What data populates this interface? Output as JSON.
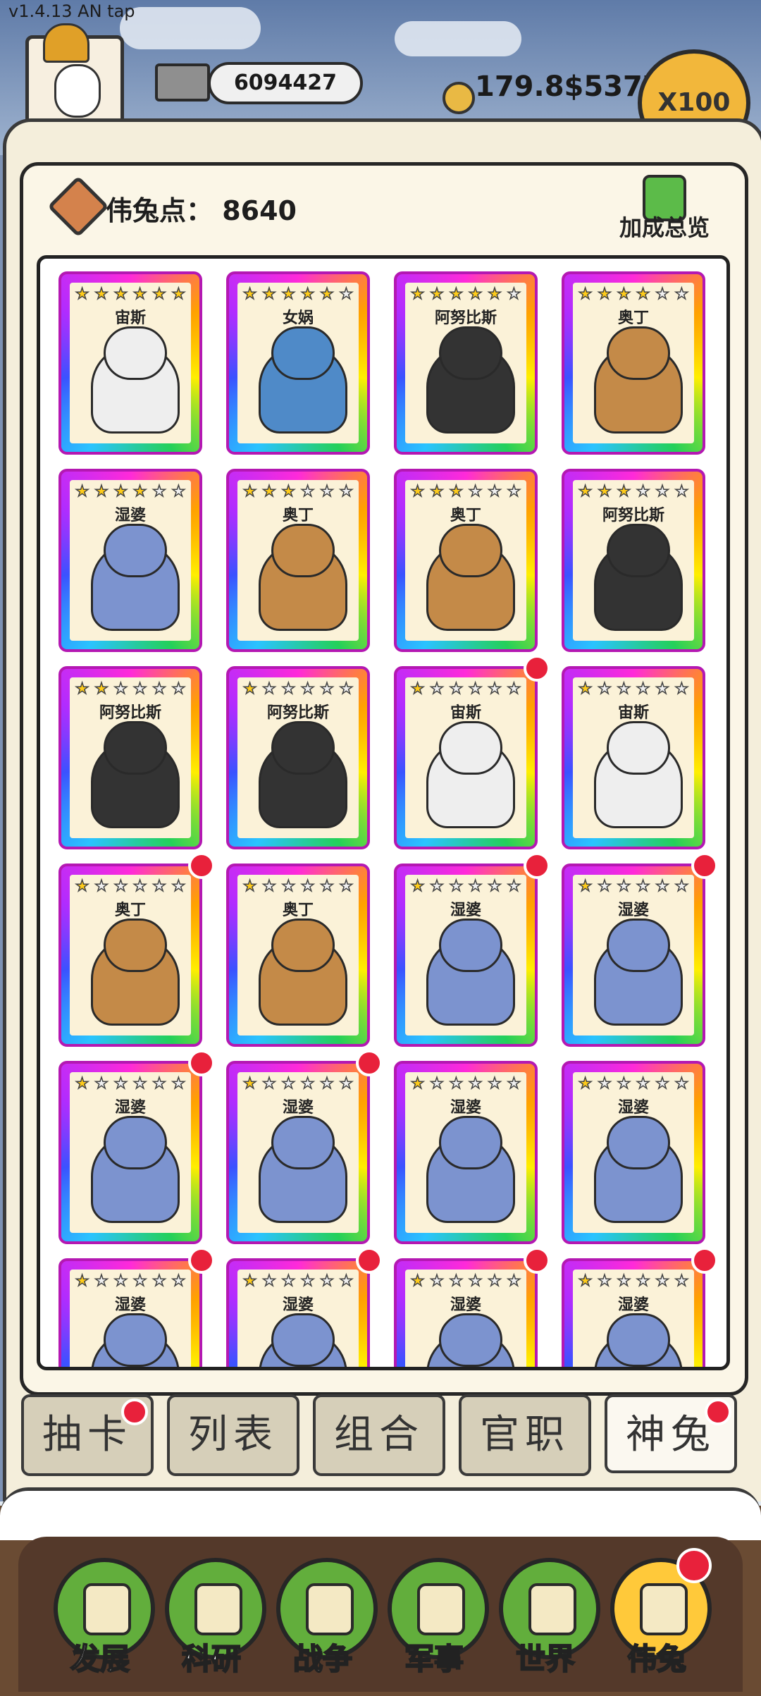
{
  "version_label": "v1.4.13 AN tap",
  "resources": {
    "silver": "6094427",
    "gold": "179.8$5377",
    "multiplier_button": "X100"
  },
  "panel": {
    "points_label": "伟兔点： 8640",
    "overview_label": "加成总览"
  },
  "cards": [
    {
      "name": "宙斯",
      "stars": 6,
      "badge": false,
      "color": "#eeeeee"
    },
    {
      "name": "女娲",
      "stars": 5,
      "badge": false,
      "color": "#4f8ac8"
    },
    {
      "name": "阿努比斯",
      "stars": 5,
      "badge": false,
      "color": "#333333"
    },
    {
      "name": "奥丁",
      "stars": 4,
      "badge": false,
      "color": "#c48a48"
    },
    {
      "name": "湿婆",
      "stars": 4,
      "badge": false,
      "color": "#7c93cf"
    },
    {
      "name": "奥丁",
      "stars": 3,
      "badge": false,
      "color": "#c48a48"
    },
    {
      "name": "奥丁",
      "stars": 3,
      "badge": false,
      "color": "#c48a48"
    },
    {
      "name": "阿努比斯",
      "stars": 3,
      "badge": false,
      "color": "#333333"
    },
    {
      "name": "阿努比斯",
      "stars": 2,
      "badge": false,
      "color": "#333333"
    },
    {
      "name": "阿努比斯",
      "stars": 1,
      "badge": false,
      "color": "#333333"
    },
    {
      "name": "宙斯",
      "stars": 1,
      "badge": true,
      "color": "#eeeeee"
    },
    {
      "name": "宙斯",
      "stars": 1,
      "badge": false,
      "color": "#eeeeee"
    },
    {
      "name": "奥丁",
      "stars": 1,
      "badge": true,
      "color": "#c48a48"
    },
    {
      "name": "奥丁",
      "stars": 1,
      "badge": false,
      "color": "#c48a48"
    },
    {
      "name": "湿婆",
      "stars": 1,
      "badge": true,
      "color": "#7c93cf"
    },
    {
      "name": "湿婆",
      "stars": 1,
      "badge": true,
      "color": "#7c93cf"
    },
    {
      "name": "湿婆",
      "stars": 1,
      "badge": true,
      "color": "#7c93cf"
    },
    {
      "name": "湿婆",
      "stars": 1,
      "badge": true,
      "color": "#7c93cf"
    },
    {
      "name": "湿婆",
      "stars": 1,
      "badge": false,
      "color": "#7c93cf"
    },
    {
      "name": "湿婆",
      "stars": 1,
      "badge": false,
      "color": "#7c93cf"
    },
    {
      "name": "湿婆",
      "stars": 1,
      "badge": true,
      "color": "#7c93cf"
    },
    {
      "name": "湿婆",
      "stars": 1,
      "badge": true,
      "color": "#7c93cf"
    },
    {
      "name": "湿婆",
      "stars": 1,
      "badge": true,
      "color": "#7c93cf"
    },
    {
      "name": "湿婆",
      "stars": 1,
      "badge": true,
      "color": "#7c93cf"
    }
  ],
  "tabs": [
    {
      "label": "抽卡",
      "badge": true,
      "active": false
    },
    {
      "label": "列表",
      "badge": false,
      "active": false
    },
    {
      "label": "组合",
      "badge": false,
      "active": false
    },
    {
      "label": "官职",
      "badge": false,
      "active": false
    },
    {
      "label": "神兔",
      "badge": true,
      "active": true
    }
  ],
  "nav": [
    {
      "label": "发展",
      "icon": "arrow-up-icon",
      "badge": false,
      "active": false
    },
    {
      "label": "科研",
      "icon": "flask-icon",
      "badge": false,
      "active": false
    },
    {
      "label": "战争",
      "icon": "crossed-swords-icon",
      "badge": false,
      "active": false
    },
    {
      "label": "军事",
      "icon": "helmet-icon",
      "badge": false,
      "active": false
    },
    {
      "label": "世界",
      "icon": "globe-icon",
      "badge": false,
      "active": false
    },
    {
      "label": "伟兔",
      "icon": "rabbit-portrait-icon",
      "badge": true,
      "active": true
    }
  ]
}
